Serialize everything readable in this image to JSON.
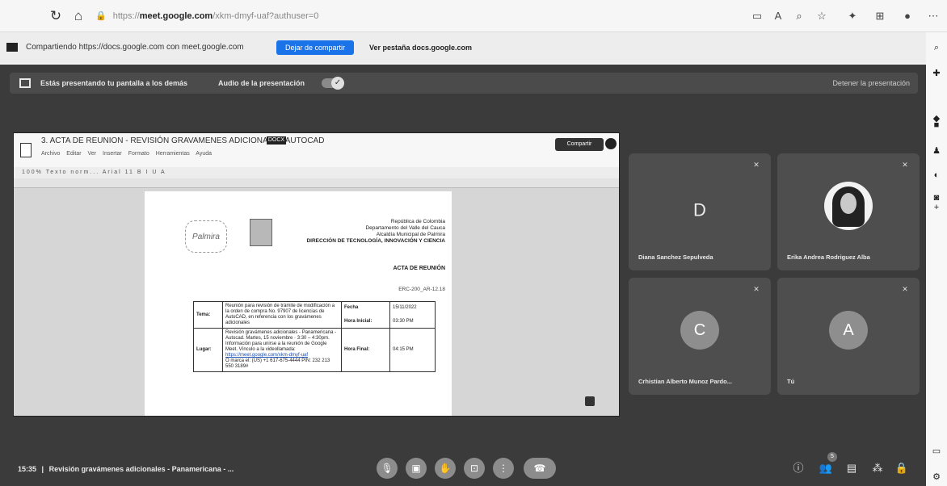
{
  "browser": {
    "url_prefix": "https://",
    "url_host": "meet.google.com",
    "url_rest": "/xkm-dmyf-uaf?authuser=0"
  },
  "share_bar": {
    "text": "Compartiendo https://docs.google.com con meet.google.com",
    "stop_button": "Dejar de compartir",
    "view_tab": "Ver pestaña docs.google.com"
  },
  "presenting_bar": {
    "text": "Estás presentando tu pantalla a los demás",
    "audio_label": "Audio de la presentación",
    "stop_button": "Detener la presentación"
  },
  "document": {
    "title": "3. ACTA DE REUNION - REVISIÓN GRAVAMENES ADICIONALES AUTOCAD",
    "badge": "DOCX",
    "menu": [
      "Archivo",
      "Editar",
      "Ver",
      "Insertar",
      "Formato",
      "Herramientas",
      "Ayuda"
    ],
    "share_button": "Compartir",
    "toolbar_text": "100%   Texto norm...   Arial   11   B  I  U  A",
    "logo_text": "Palmira",
    "header_lines": [
      "República de Colombia",
      "Departamento del Valle del Cauca",
      "Alcaldía Municipal de Palmira"
    ],
    "header_bold": "DIRECCIÓN DE TECNOLOGÍA, INNOVACIÓN Y CIENCIA",
    "acta_title": "ACTA DE REUNIÓN",
    "acta_code": "ERC-200_AR-12.18",
    "table": {
      "tema_label": "Tema:",
      "tema_value": "Reunión para revisión de trámite de modificación a la orden de compra No. 97907 de licencias de AutoCAD, en referencia con los gravámenes adicionales",
      "fecha_label": "Fecha",
      "fecha_value": "15/11/2022",
      "hora_inicial_label": "Hora Inicial:",
      "hora_inicial_value": "03:30 PM",
      "lugar_label": "Lugar:",
      "lugar_value_1": "Revisión gravámenes adicionales - Panamericana - Autocad. Martes, 15 noviembre · 3:30 – 4:30pm. Información para unirse a la reunión de Google Meet. Vínculo a la videollamada:",
      "lugar_link": "https://meet.google.com/xkm-dmyf-uaf",
      "lugar_value_2": "O marca el: (US) +1 617-675-4444 PIN: 232 213 550 3189#",
      "hora_final_label": "Hora Final:",
      "hora_final_value": "04:15 PM"
    }
  },
  "participants": [
    {
      "initial": "D",
      "name": "Diana Sanchez Sepulveda",
      "type": "letter"
    },
    {
      "initial": "",
      "name": "Erika Andrea Rodriguez Alba",
      "type": "photo"
    },
    {
      "initial": "C",
      "name": "Crhistian Alberto Munoz Pardo...",
      "type": "circle"
    },
    {
      "initial": "A",
      "name": "Tú",
      "type": "circle"
    }
  ],
  "meeting": {
    "time": "15:35",
    "separator": "|",
    "title": "Revisión gravámenes adicionales - Panamericana - ..."
  },
  "participants_count": "5",
  "colors": {
    "meet_background": "#3b3b3b",
    "tile_background": "#4e4e4e",
    "stop_share_blue": "#1a73e8"
  }
}
